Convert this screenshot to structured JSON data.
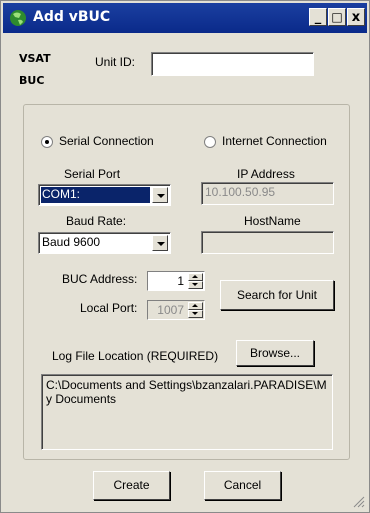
{
  "window": {
    "title": "Add vBUC",
    "controls": {
      "minimize": "_",
      "maximize": "□",
      "close": "x"
    }
  },
  "logo": {
    "line1": "VSAT",
    "line2": "BUC"
  },
  "unit_id": {
    "label": "Unit ID:",
    "value": ""
  },
  "connection": {
    "serial_label": "Serial Connection",
    "internet_label": "Internet Connection",
    "selected": "serial"
  },
  "serial": {
    "port_label": "Serial Port",
    "port_value": "COM1:",
    "baud_label": "Baud Rate:",
    "baud_value": "Baud 9600"
  },
  "internet": {
    "ip_label": "IP Address",
    "ip_value": "10.100.50.95",
    "host_label": "HostName",
    "host_value": ""
  },
  "buc_address": {
    "label": "BUC Address:",
    "value": "1"
  },
  "local_port": {
    "label": "Local Port:",
    "value": "1007"
  },
  "search_button": "Search for Unit",
  "log": {
    "label": "Log File Location (REQUIRED)",
    "browse_button": "Browse...",
    "path": "C:\\Documents and Settings\\bzanzalari.PARADISE\\My Documents"
  },
  "footer": {
    "create_button": "Create",
    "cancel_button": "Cancel"
  }
}
